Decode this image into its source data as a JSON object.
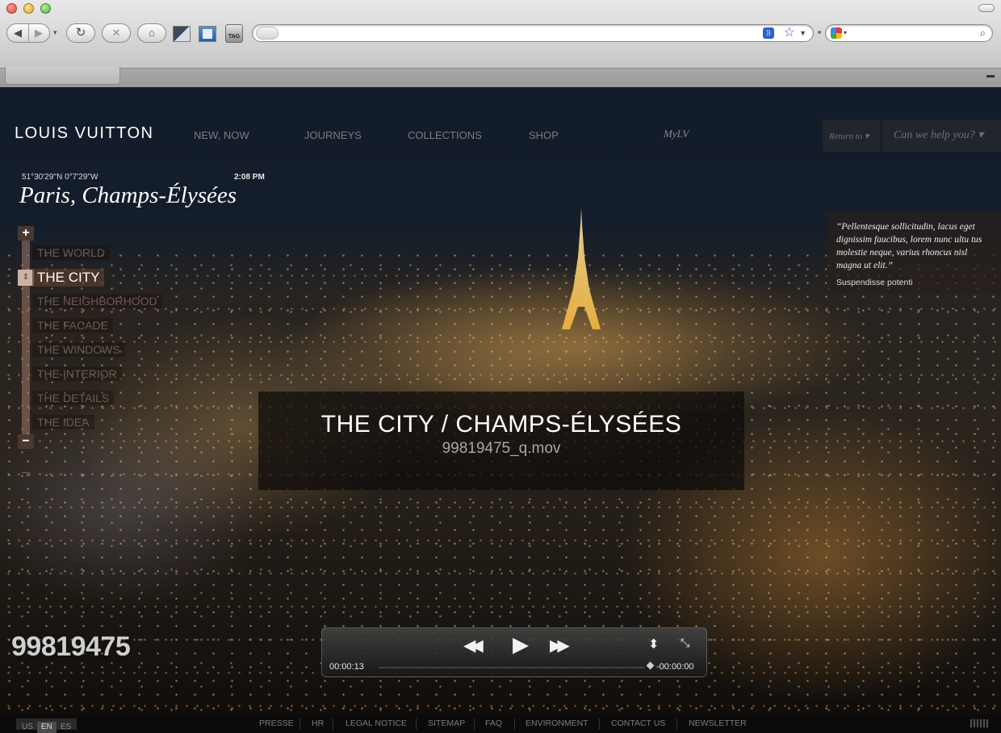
{
  "browser": {
    "tag_label": "TAG",
    "url": ""
  },
  "site": {
    "logo": "LOUIS VUITTON",
    "nav": [
      "NEW, NOW",
      "JOURNEYS",
      "COLLECTIONS",
      "SHOP"
    ],
    "my_lv": "MyLV",
    "return_to": "Return to ▾",
    "help": "Can we help you? ▾"
  },
  "location": {
    "coords": "51°30'29''N 0°7'29''W",
    "time": "2:08 PM",
    "place": "Paris, Champs-Élysées"
  },
  "zoom": {
    "levels": [
      "THE WORLD",
      "THE CITY",
      "THE NEIGHBORHOOD",
      "THE FACADE",
      "THE WINDOWS",
      "THE INTERIOR",
      "THE DETAILS",
      "THE IDEA"
    ],
    "active_index": 1
  },
  "quote": {
    "text": "“Pellentesque sollicitudin, lacus eget dignissim faucibus, lorem nunc ultu tus molestie neque,  varius rhoncus nisl magna ut elit.”",
    "author": "Suspendisse potenti"
  },
  "video": {
    "title": "THE CITY / CHAMPS-ÉLYSÉES",
    "filename": "99819475_q.mov",
    "overlay_number": "99819475",
    "elapsed": "00:00:13",
    "remaining": "-00:00:00"
  },
  "footer": {
    "languages": [
      "US",
      "EN",
      "ES"
    ],
    "selected_language": "EN",
    "links": [
      "PRESSE",
      "HR",
      "LEGAL NOTICE",
      "SITEMAP",
      "FAQ",
      "ENVIRONMENT",
      "CONTACT US",
      "NEWSLETTER"
    ]
  },
  "colors": {
    "accent": "#4a3830",
    "active_level_bg": "#5a3c2d",
    "text_primary": "#ffffff"
  }
}
